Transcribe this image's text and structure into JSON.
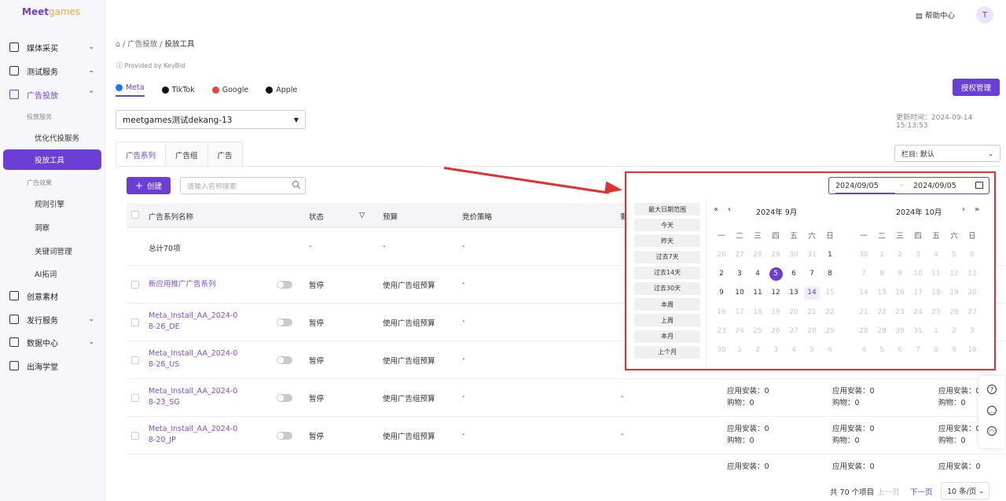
{
  "brand": {
    "logo_main": "Meet",
    "logo_accent": "games"
  },
  "topbar": {
    "help": "帮助中心",
    "avatar_initial": "T"
  },
  "sidebar": {
    "items": [
      {
        "label": "媒体采买",
        "icon": "store-icon"
      },
      {
        "label": "测试服务",
        "icon": "folder-icon"
      },
      {
        "label": "广告投放",
        "icon": "ad-icon"
      },
      {
        "label": "创意素材",
        "icon": "image-icon"
      },
      {
        "label": "发行服务",
        "icon": "publish-icon"
      },
      {
        "label": "数据中心",
        "icon": "chart-icon"
      },
      {
        "label": "出海学堂",
        "icon": "graduation-icon"
      }
    ],
    "group_service": "投放服务",
    "sub_service": [
      "优化代投服务",
      "投放工具"
    ],
    "group_effect": "广告效果",
    "sub_effect": [
      "规则引擎",
      "洞察",
      "关键词管理",
      "AI拓词"
    ]
  },
  "breadcrumb": {
    "p1": "广告投放",
    "p2": "投放工具"
  },
  "provided_by": "Provided by KeyBid",
  "platform_tabs": [
    "Meta",
    "TikTok",
    "Google",
    "Apple"
  ],
  "auth_button": "授权管理",
  "account_select": "meetgames测试dekang-13",
  "updated_time": "更新时间：2024-09-14 15:13:53",
  "tabs": [
    "广告系列",
    "广告组",
    "广告"
  ],
  "column_select": "栏目: 默认",
  "create_button": "创建",
  "search_placeholder": "请输入名称搜索",
  "table": {
    "headers": [
      "广告系列名称",
      "状态",
      "预算",
      "竞价策略",
      "剩"
    ],
    "total_row": {
      "name": "总计70项",
      "status": "-",
      "budget": "-",
      "bid": "-"
    },
    "rows": [
      {
        "name": "新应用推广广告系列",
        "status": "暂停",
        "budget": "使用广告组预算",
        "bid": "-"
      },
      {
        "name": "Meta_Install_AA_2024-08-26_DE",
        "status": "暂停",
        "budget": "使用广告组预算",
        "bid": "-"
      },
      {
        "name": "Meta_Install_AA_2024-08-26_US",
        "status": "暂停",
        "budget": "使用广告组预算",
        "bid": "-"
      },
      {
        "name": "Meta_Install_AA_2024-08-23_SG",
        "status": "暂停",
        "budget": "使用广告组预算",
        "bid": "-",
        "extra": "-"
      },
      {
        "name": "Meta_Install_AA_2024-08-20_JP",
        "status": "暂停",
        "budget": "使用广告组预算",
        "bid": "-",
        "extra": "-"
      }
    ],
    "metric_install": "应用安装：0",
    "metric_purchase": "购物：0"
  },
  "pagination": {
    "total": "共 70 个项目",
    "prev": "上一页",
    "next": "下一页",
    "per_page": "10 条/页"
  },
  "datepicker": {
    "start": "2024/09/05",
    "sep": "–",
    "end": "2024/09/05",
    "presets": [
      "最大日期范围",
      "今天",
      "昨天",
      "过去7天",
      "过去14天",
      "过去30天",
      "本周",
      "上周",
      "本月",
      "上个月"
    ],
    "left_title": "2024年  9月",
    "right_title": "2024年  10月",
    "weekdays": [
      "一",
      "二",
      "三",
      "四",
      "五",
      "六",
      "日"
    ],
    "left_days": [
      [
        "26",
        "27",
        "28",
        "29",
        "30",
        "31",
        "1"
      ],
      [
        "2",
        "3",
        "4",
        "5",
        "6",
        "7",
        "8"
      ],
      [
        "9",
        "10",
        "11",
        "12",
        "13",
        "14",
        "15"
      ],
      [
        "16",
        "17",
        "18",
        "19",
        "20",
        "21",
        "22"
      ],
      [
        "23",
        "24",
        "25",
        "26",
        "27",
        "28",
        "29"
      ],
      [
        "30",
        "1",
        "2",
        "3",
        "4",
        "5",
        "6"
      ]
    ],
    "right_days": [
      [
        "30",
        "1",
        "2",
        "3",
        "4",
        "5",
        "6"
      ],
      [
        "7",
        "8",
        "9",
        "10",
        "11",
        "12",
        "13"
      ],
      [
        "14",
        "15",
        "16",
        "17",
        "18",
        "19",
        "20"
      ],
      [
        "21",
        "22",
        "23",
        "24",
        "25",
        "26",
        "27"
      ],
      [
        "28",
        "29",
        "30",
        "31",
        "1",
        "2",
        "3"
      ],
      [
        "4",
        "5",
        "6",
        "7",
        "8",
        "9",
        "10"
      ]
    ],
    "selected_day": "5",
    "today_day": "14",
    "nav_prev_year": "«",
    "nav_prev_month": "‹",
    "nav_next_month": "›",
    "nav_next_year": "»"
  },
  "colors": {
    "accent": "#6b3fd4",
    "highlight": "#e03131"
  }
}
